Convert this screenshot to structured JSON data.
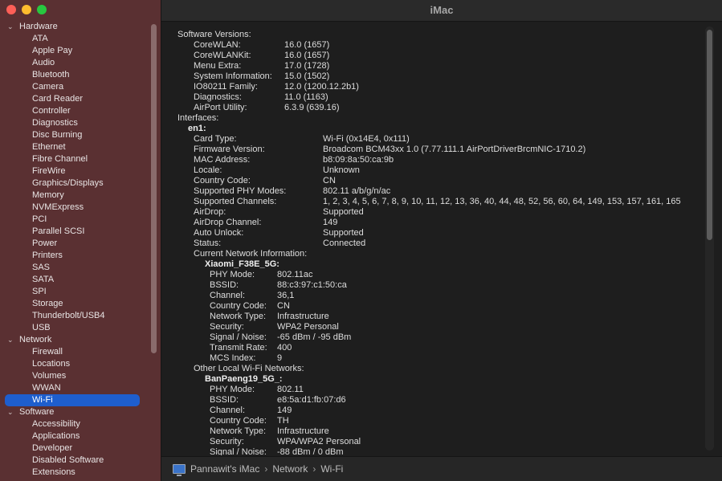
{
  "window": {
    "title": "iMac"
  },
  "sidebar": {
    "sections": [
      {
        "label": "Hardware",
        "items": [
          "ATA",
          "Apple Pay",
          "Audio",
          "Bluetooth",
          "Camera",
          "Card Reader",
          "Controller",
          "Diagnostics",
          "Disc Burning",
          "Ethernet",
          "Fibre Channel",
          "FireWire",
          "Graphics/Displays",
          "Memory",
          "NVMExpress",
          "PCI",
          "Parallel SCSI",
          "Power",
          "Printers",
          "SAS",
          "SATA",
          "SPI",
          "Storage",
          "Thunderbolt/USB4",
          "USB"
        ]
      },
      {
        "label": "Network",
        "items": [
          "Firewall",
          "Locations",
          "Volumes",
          "WWAN",
          "Wi-Fi"
        ]
      },
      {
        "label": "Software",
        "items": [
          "Accessibility",
          "Applications",
          "Developer",
          "Disabled Software",
          "Extensions"
        ]
      }
    ],
    "selected": "Wi-Fi"
  },
  "content": {
    "software_versions_label": "Software Versions:",
    "software_versions": [
      {
        "key": "CoreWLAN:",
        "value": "16.0 (1657)"
      },
      {
        "key": "CoreWLANKit:",
        "value": "16.0 (1657)"
      },
      {
        "key": "Menu Extra:",
        "value": "17.0 (1728)"
      },
      {
        "key": "System Information:",
        "value": "15.0 (1502)"
      },
      {
        "key": "IO80211 Family:",
        "value": "12.0 (1200.12.2b1)"
      },
      {
        "key": "Diagnostics:",
        "value": "11.0 (1163)"
      },
      {
        "key": "AirPort Utility:",
        "value": "6.3.9 (639.16)"
      }
    ],
    "interfaces_label": "Interfaces:",
    "interface_name": "en1:",
    "interface_props": [
      {
        "key": "Card Type:",
        "value": "Wi-Fi  (0x14E4, 0x111)"
      },
      {
        "key": "Firmware Version:",
        "value": "Broadcom BCM43xx 1.0 (7.77.111.1 AirPortDriverBrcmNIC-1710.2)"
      },
      {
        "key": "MAC Address:",
        "value": "b8:09:8a:50:ca:9b"
      },
      {
        "key": "Locale:",
        "value": "Unknown"
      },
      {
        "key": "Country Code:",
        "value": "CN"
      },
      {
        "key": "Supported PHY Modes:",
        "value": "802.11 a/b/g/n/ac"
      },
      {
        "key": "Supported Channels:",
        "value": "1, 2, 3, 4, 5, 6, 7, 8, 9, 10, 11, 12, 13, 36, 40, 44, 48, 52, 56, 60, 64, 149, 153, 157, 161, 165"
      },
      {
        "key": "AirDrop:",
        "value": "Supported"
      },
      {
        "key": "AirDrop Channel:",
        "value": "149"
      },
      {
        "key": "Auto Unlock:",
        "value": "Supported"
      },
      {
        "key": "Status:",
        "value": "Connected"
      }
    ],
    "current_network_label": "Current Network Information:",
    "current_network_name": "Xiaomi_F38E_5G:",
    "current_network": [
      {
        "key": "PHY Mode:",
        "value": "802.11ac"
      },
      {
        "key": "BSSID:",
        "value": "88:c3:97:c1:50:ca"
      },
      {
        "key": "Channel:",
        "value": "36,1"
      },
      {
        "key": "Country Code:",
        "value": "CN"
      },
      {
        "key": "Network Type:",
        "value": "Infrastructure"
      },
      {
        "key": "Security:",
        "value": "WPA2 Personal"
      },
      {
        "key": "Signal / Noise:",
        "value": "-65 dBm / -95 dBm"
      },
      {
        "key": "Transmit Rate:",
        "value": "400"
      },
      {
        "key": "MCS Index:",
        "value": "9"
      }
    ],
    "other_networks_label": "Other Local Wi-Fi Networks:",
    "other_network_name": "BanPaeng19_5G_:",
    "other_network": [
      {
        "key": "PHY Mode:",
        "value": "802.11"
      },
      {
        "key": "BSSID:",
        "value": "e8:5a:d1:fb:07:d6"
      },
      {
        "key": "Channel:",
        "value": "149"
      },
      {
        "key": "Country Code:",
        "value": "TH"
      },
      {
        "key": "Network Type:",
        "value": "Infrastructure"
      },
      {
        "key": "Security:",
        "value": "WPA/WPA2 Personal"
      },
      {
        "key": "Signal / Noise:",
        "value": "-88 dBm / 0 dBm"
      }
    ]
  },
  "breadcrumb": {
    "items": [
      "Pannawit's iMac",
      "Network",
      "Wi-Fi"
    ],
    "separator": "›"
  }
}
